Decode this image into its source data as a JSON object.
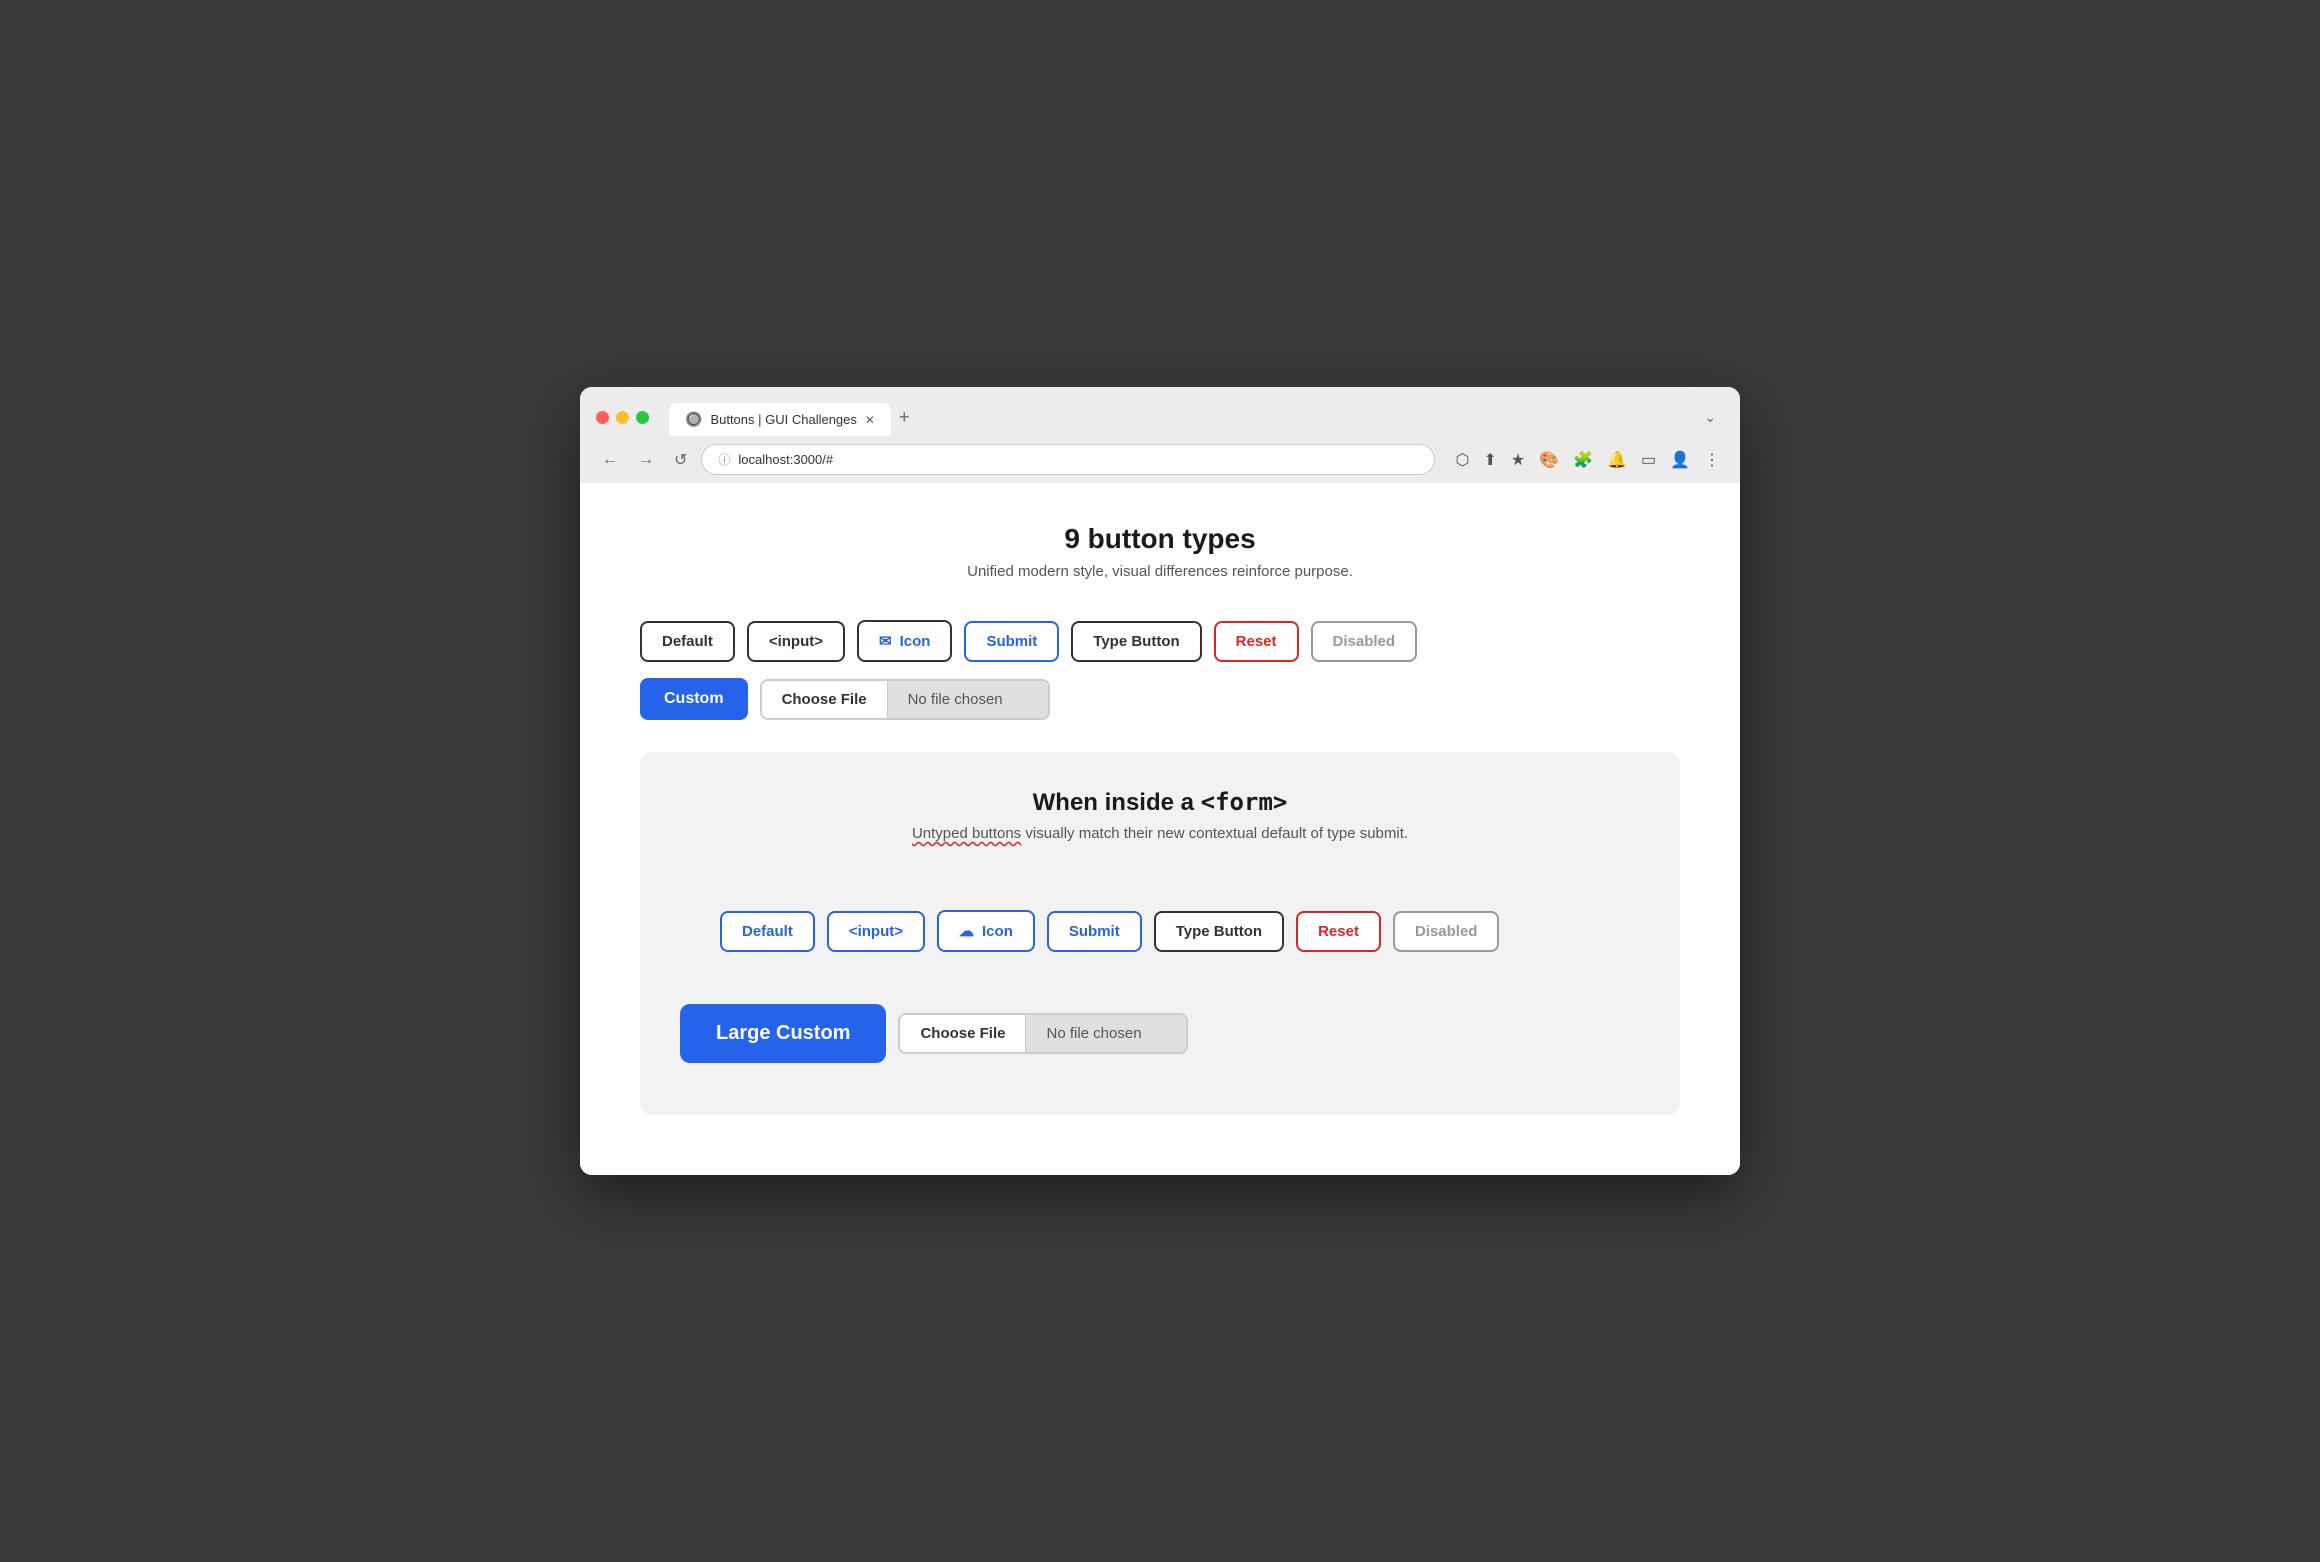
{
  "browser": {
    "traffic_lights": [
      "red",
      "yellow",
      "green"
    ],
    "tab_label": "Buttons | GUI Challenges",
    "tab_close": "✕",
    "tab_new": "+",
    "tab_expand": "⌄",
    "nav_back": "←",
    "nav_forward": "→",
    "nav_reload": "↺",
    "address": "localhost:3000/#",
    "address_icon": "ⓘ",
    "nav_icons": [
      "⬡",
      "⬆",
      "★",
      "🎨",
      "🧩",
      "🔔",
      "▭",
      "👤",
      "⋮"
    ]
  },
  "page": {
    "title": "9 button types",
    "subtitle": "Unified modern style, visual differences reinforce purpose."
  },
  "buttons_row1": [
    {
      "id": "default",
      "label": "Default",
      "type": "default"
    },
    {
      "id": "input",
      "label": "<input>",
      "type": "input"
    },
    {
      "id": "icon",
      "label": "Icon",
      "type": "icon",
      "icon": "✉"
    },
    {
      "id": "submit",
      "label": "Submit",
      "type": "submit"
    },
    {
      "id": "type-button",
      "label": "Type Button",
      "type": "type-button"
    },
    {
      "id": "reset",
      "label": "Reset",
      "type": "reset"
    },
    {
      "id": "disabled",
      "label": "Disabled",
      "type": "disabled"
    }
  ],
  "buttons_row2": {
    "custom_label": "Custom",
    "file_choose_label": "Choose File",
    "file_no_chosen": "No file chosen"
  },
  "form_section": {
    "title_prefix": "When inside a ",
    "title_code": "<form>",
    "subtitle_plain": " visually match their new contextual default of type submit.",
    "subtitle_underlined": "Untyped buttons",
    "buttons_row1": [
      {
        "id": "default",
        "label": "Default",
        "type": "default"
      },
      {
        "id": "input",
        "label": "<input>",
        "type": "input"
      },
      {
        "id": "icon",
        "label": "Icon",
        "type": "icon",
        "icon": "☁"
      },
      {
        "id": "submit",
        "label": "Submit",
        "type": "submit"
      },
      {
        "id": "type-button",
        "label": "Type Button",
        "type": "type-button"
      },
      {
        "id": "reset",
        "label": "Reset",
        "type": "reset"
      },
      {
        "id": "disabled",
        "label": "Disabled",
        "type": "disabled"
      }
    ],
    "large_custom_label": "Large Custom",
    "file_choose_label": "Choose File",
    "file_no_chosen": "No file chosen"
  }
}
